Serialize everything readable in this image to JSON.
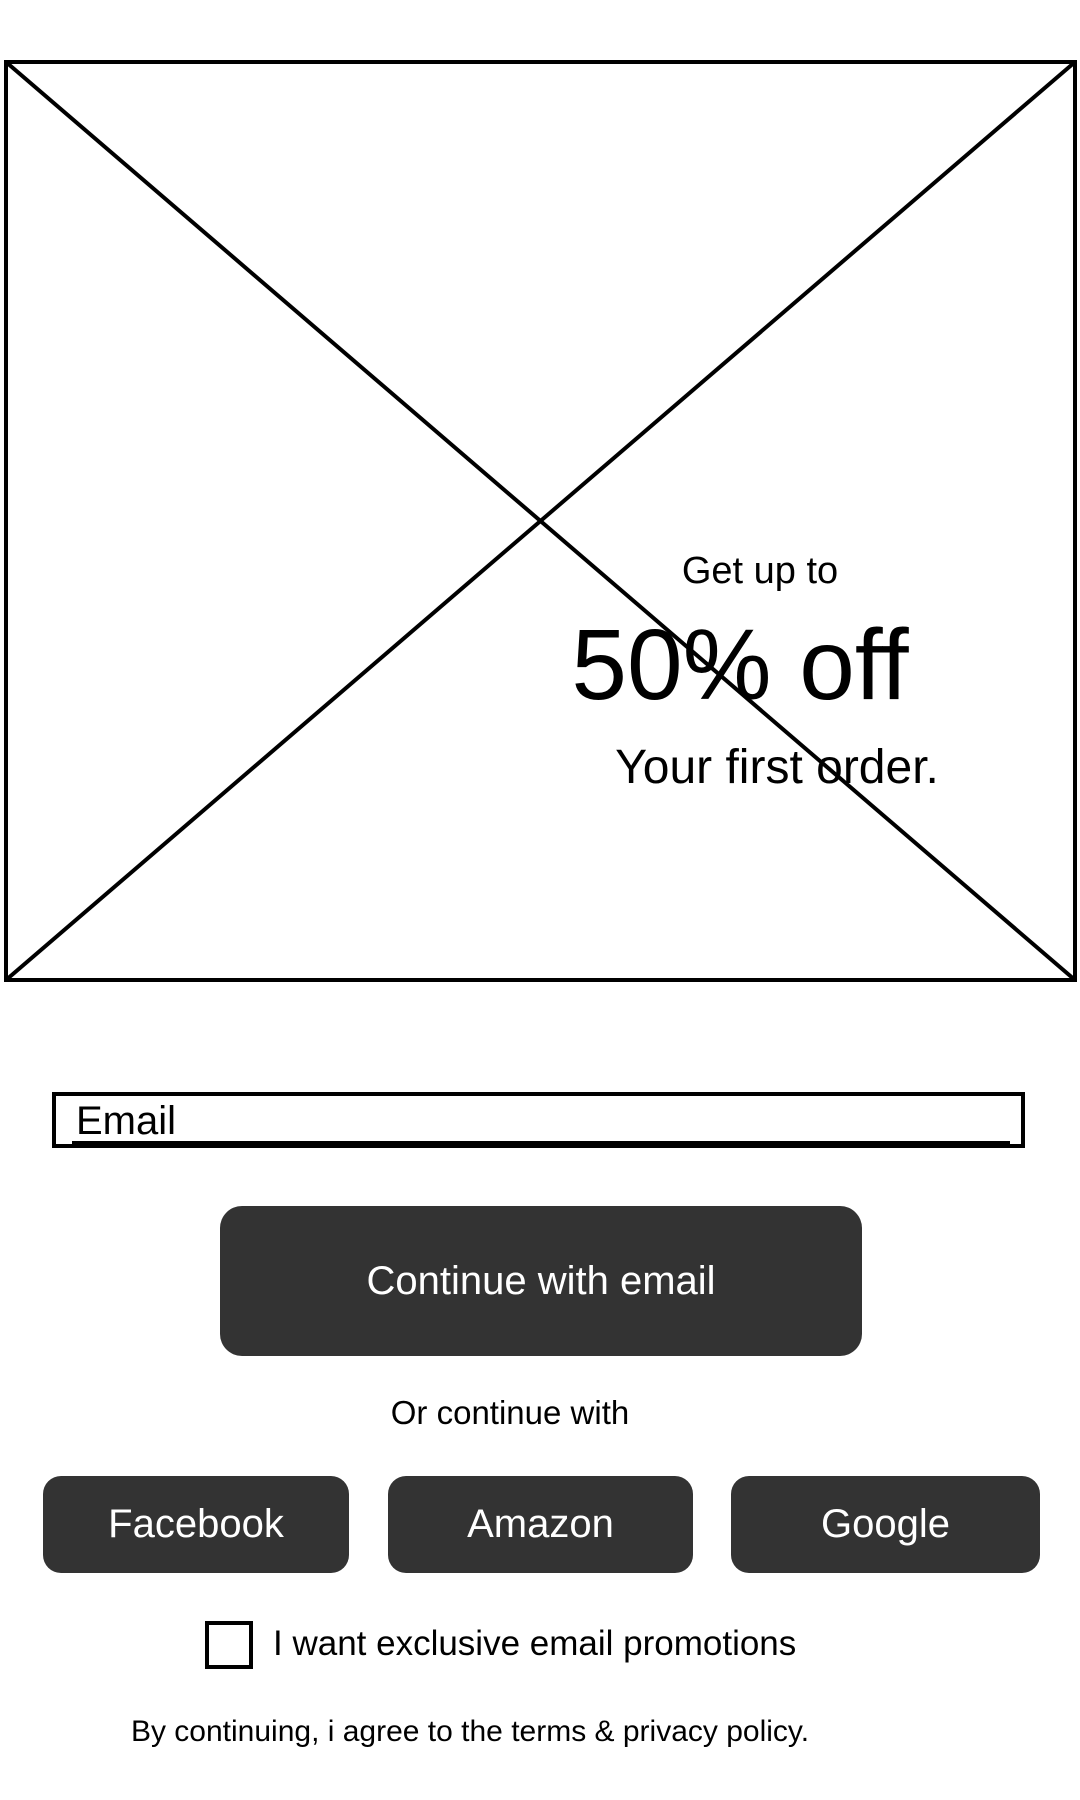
{
  "promo": {
    "intro": "Get up to",
    "headline": "50% off",
    "subline": "Your first order."
  },
  "email": {
    "placeholder": "Email",
    "value": ""
  },
  "primary_button": {
    "label": "Continue with email"
  },
  "divider_text": "Or continue with",
  "social_buttons": [
    {
      "label": "Facebook"
    },
    {
      "label": "Amazon"
    },
    {
      "label": "Google"
    }
  ],
  "promotions_opt_in": {
    "label": "I want exclusive email promotions",
    "checked": false
  },
  "terms_text": "By continuing, i agree to the terms & privacy policy.",
  "colors": {
    "button_background": "#333333",
    "button_text": "#ffffff",
    "outline": "#000000"
  },
  "icons": {
    "hero_placeholder": "image-placeholder-icon"
  }
}
